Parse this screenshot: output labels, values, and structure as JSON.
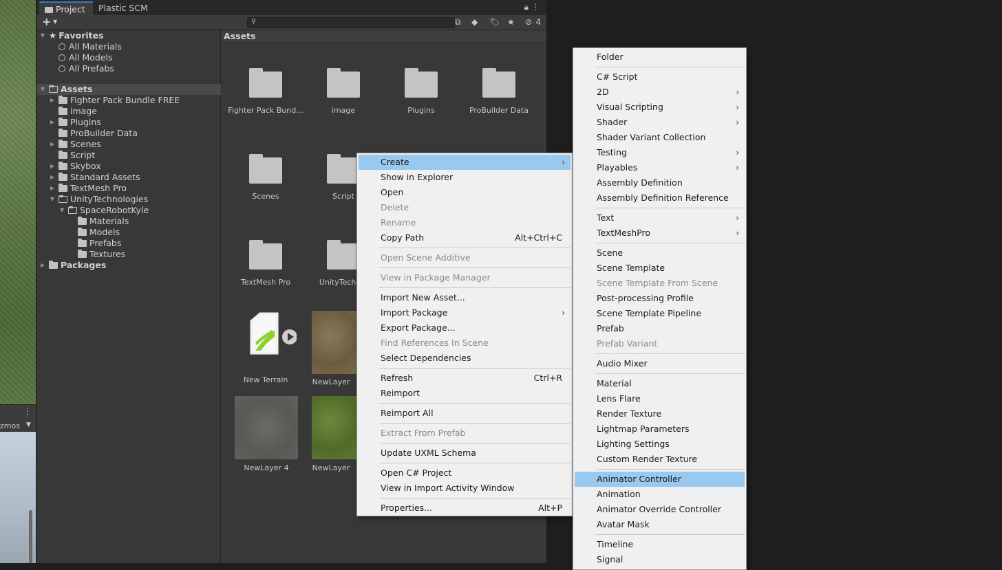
{
  "scene": {
    "gizmos_label": "zmos"
  },
  "tabs": [
    {
      "label": "Project"
    },
    {
      "label": "Plastic SCM"
    }
  ],
  "toolbar": {
    "hidden_count": "4"
  },
  "tree": {
    "favorites": {
      "label": "Favorites",
      "items": [
        "All Materials",
        "All Models",
        "All Prefabs"
      ]
    },
    "assets_label": "Assets",
    "assets_items": [
      {
        "label": "Fighter Pack Bundle FREE",
        "expandable": true
      },
      {
        "label": "image",
        "expandable": false
      },
      {
        "label": "Plugins",
        "expandable": true
      },
      {
        "label": "ProBuilder Data",
        "expandable": false
      },
      {
        "label": "Scenes",
        "expandable": true
      },
      {
        "label": "Script",
        "expandable": false
      },
      {
        "label": "Skybox",
        "expandable": true
      },
      {
        "label": "Standard Assets",
        "expandable": true
      },
      {
        "label": "TextMesh Pro",
        "expandable": true
      },
      {
        "label": "UnityTechnologies",
        "expandable": true
      }
    ],
    "space_robot": "SpaceRobotKyle",
    "space_robot_children": [
      "Materials",
      "Models",
      "Prefabs",
      "Textures"
    ],
    "packages_label": "Packages"
  },
  "grid": {
    "header": "Assets",
    "folders": [
      "Fighter Pack Bund...",
      "image",
      "Plugins",
      "ProBuilder Data",
      "Scenes",
      "Script",
      "TextMesh Pro",
      "UnityTechnol"
    ],
    "new_terrain": "New Terrain",
    "new_layer_a": "NewLayer",
    "new_layer_4": "NewLayer 4",
    "new_layer_b": "NewLayer"
  },
  "context_menu": {
    "items": [
      {
        "label": "Create",
        "submenu": true,
        "highlight": true
      },
      {
        "label": "Show in Explorer"
      },
      {
        "label": "Open"
      },
      {
        "label": "Delete",
        "disabled": true
      },
      {
        "label": "Rename",
        "disabled": true
      },
      {
        "label": "Copy Path",
        "shortcut": "Alt+Ctrl+C"
      },
      {
        "separator": true
      },
      {
        "label": "Open Scene Additive",
        "disabled": true
      },
      {
        "separator": true
      },
      {
        "label": "View in Package Manager",
        "disabled": true
      },
      {
        "separator": true
      },
      {
        "label": "Import New Asset..."
      },
      {
        "label": "Import Package",
        "submenu": true
      },
      {
        "label": "Export Package..."
      },
      {
        "label": "Find References In Scene",
        "disabled": true
      },
      {
        "label": "Select Dependencies"
      },
      {
        "separator": true
      },
      {
        "label": "Refresh",
        "shortcut": "Ctrl+R"
      },
      {
        "label": "Reimport"
      },
      {
        "separator": true
      },
      {
        "label": "Reimport All"
      },
      {
        "separator": true
      },
      {
        "label": "Extract From Prefab",
        "disabled": true
      },
      {
        "separator": true
      },
      {
        "label": "Update UXML Schema"
      },
      {
        "separator": true
      },
      {
        "label": "Open C# Project"
      },
      {
        "label": "View in Import Activity Window"
      },
      {
        "separator": true
      },
      {
        "label": "Properties...",
        "shortcut": "Alt+P"
      }
    ]
  },
  "create_menu": {
    "items": [
      {
        "label": "Folder"
      },
      {
        "separator": true
      },
      {
        "label": "C# Script"
      },
      {
        "label": "2D",
        "submenu": true
      },
      {
        "label": "Visual Scripting",
        "submenu": true
      },
      {
        "label": "Shader",
        "submenu": true
      },
      {
        "label": "Shader Variant Collection"
      },
      {
        "label": "Testing",
        "submenu": true
      },
      {
        "label": "Playables",
        "submenu": true
      },
      {
        "label": "Assembly Definition"
      },
      {
        "label": "Assembly Definition Reference"
      },
      {
        "separator": true
      },
      {
        "label": "Text",
        "submenu": true
      },
      {
        "label": "TextMeshPro",
        "submenu": true
      },
      {
        "separator": true
      },
      {
        "label": "Scene"
      },
      {
        "label": "Scene Template"
      },
      {
        "label": "Scene Template From Scene",
        "disabled": true
      },
      {
        "label": "Post-processing Profile"
      },
      {
        "label": "Scene Template Pipeline"
      },
      {
        "label": "Prefab"
      },
      {
        "label": "Prefab Variant",
        "disabled": true
      },
      {
        "separator": true
      },
      {
        "label": "Audio Mixer"
      },
      {
        "separator": true
      },
      {
        "label": "Material"
      },
      {
        "label": "Lens Flare"
      },
      {
        "label": "Render Texture"
      },
      {
        "label": "Lightmap Parameters"
      },
      {
        "label": "Lighting Settings"
      },
      {
        "label": "Custom Render Texture"
      },
      {
        "separator": true
      },
      {
        "label": "Animator Controller",
        "highlight": true
      },
      {
        "label": "Animation"
      },
      {
        "label": "Animator Override Controller"
      },
      {
        "label": "Avatar Mask"
      },
      {
        "separator": true
      },
      {
        "label": "Timeline"
      },
      {
        "label": "Signal"
      }
    ]
  }
}
